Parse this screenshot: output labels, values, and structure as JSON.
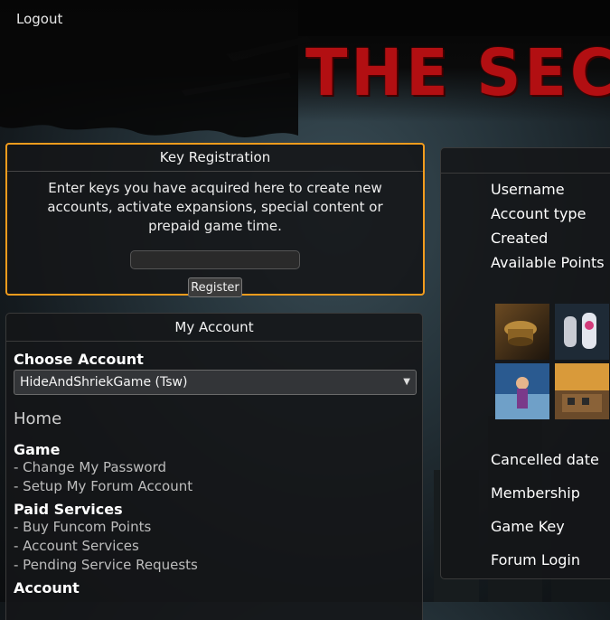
{
  "header": {
    "logout_label": "Logout",
    "logo_text": "THE SEC"
  },
  "key_registration": {
    "title": "Key Registration",
    "description": "Enter keys you have acquired here to create new accounts, activate expansions, special content or prepaid game time.",
    "input_value": "",
    "register_label": "Register"
  },
  "my_account": {
    "title": "My Account",
    "choose_account_label": "Choose Account",
    "selected_account": "HideAndShriekGame (Tsw)",
    "home_label": "Home",
    "game_heading": "Game",
    "game_links": [
      "- Change My Password",
      "- Setup My Forum Account"
    ],
    "paid_heading": "Paid Services",
    "paid_links": [
      "- Buy Funcom Points",
      "- Account Services",
      "- Pending Service Requests"
    ],
    "next_heading": "Account"
  },
  "account_info": {
    "labels": [
      "Username",
      "Account type",
      "Created",
      "Available Points"
    ],
    "lower_labels": [
      "Cancelled date",
      "Membership",
      "Game Key",
      "Forum Login"
    ]
  },
  "colors": {
    "accent": "#f39c1d",
    "logo_red": "#b20f12"
  }
}
